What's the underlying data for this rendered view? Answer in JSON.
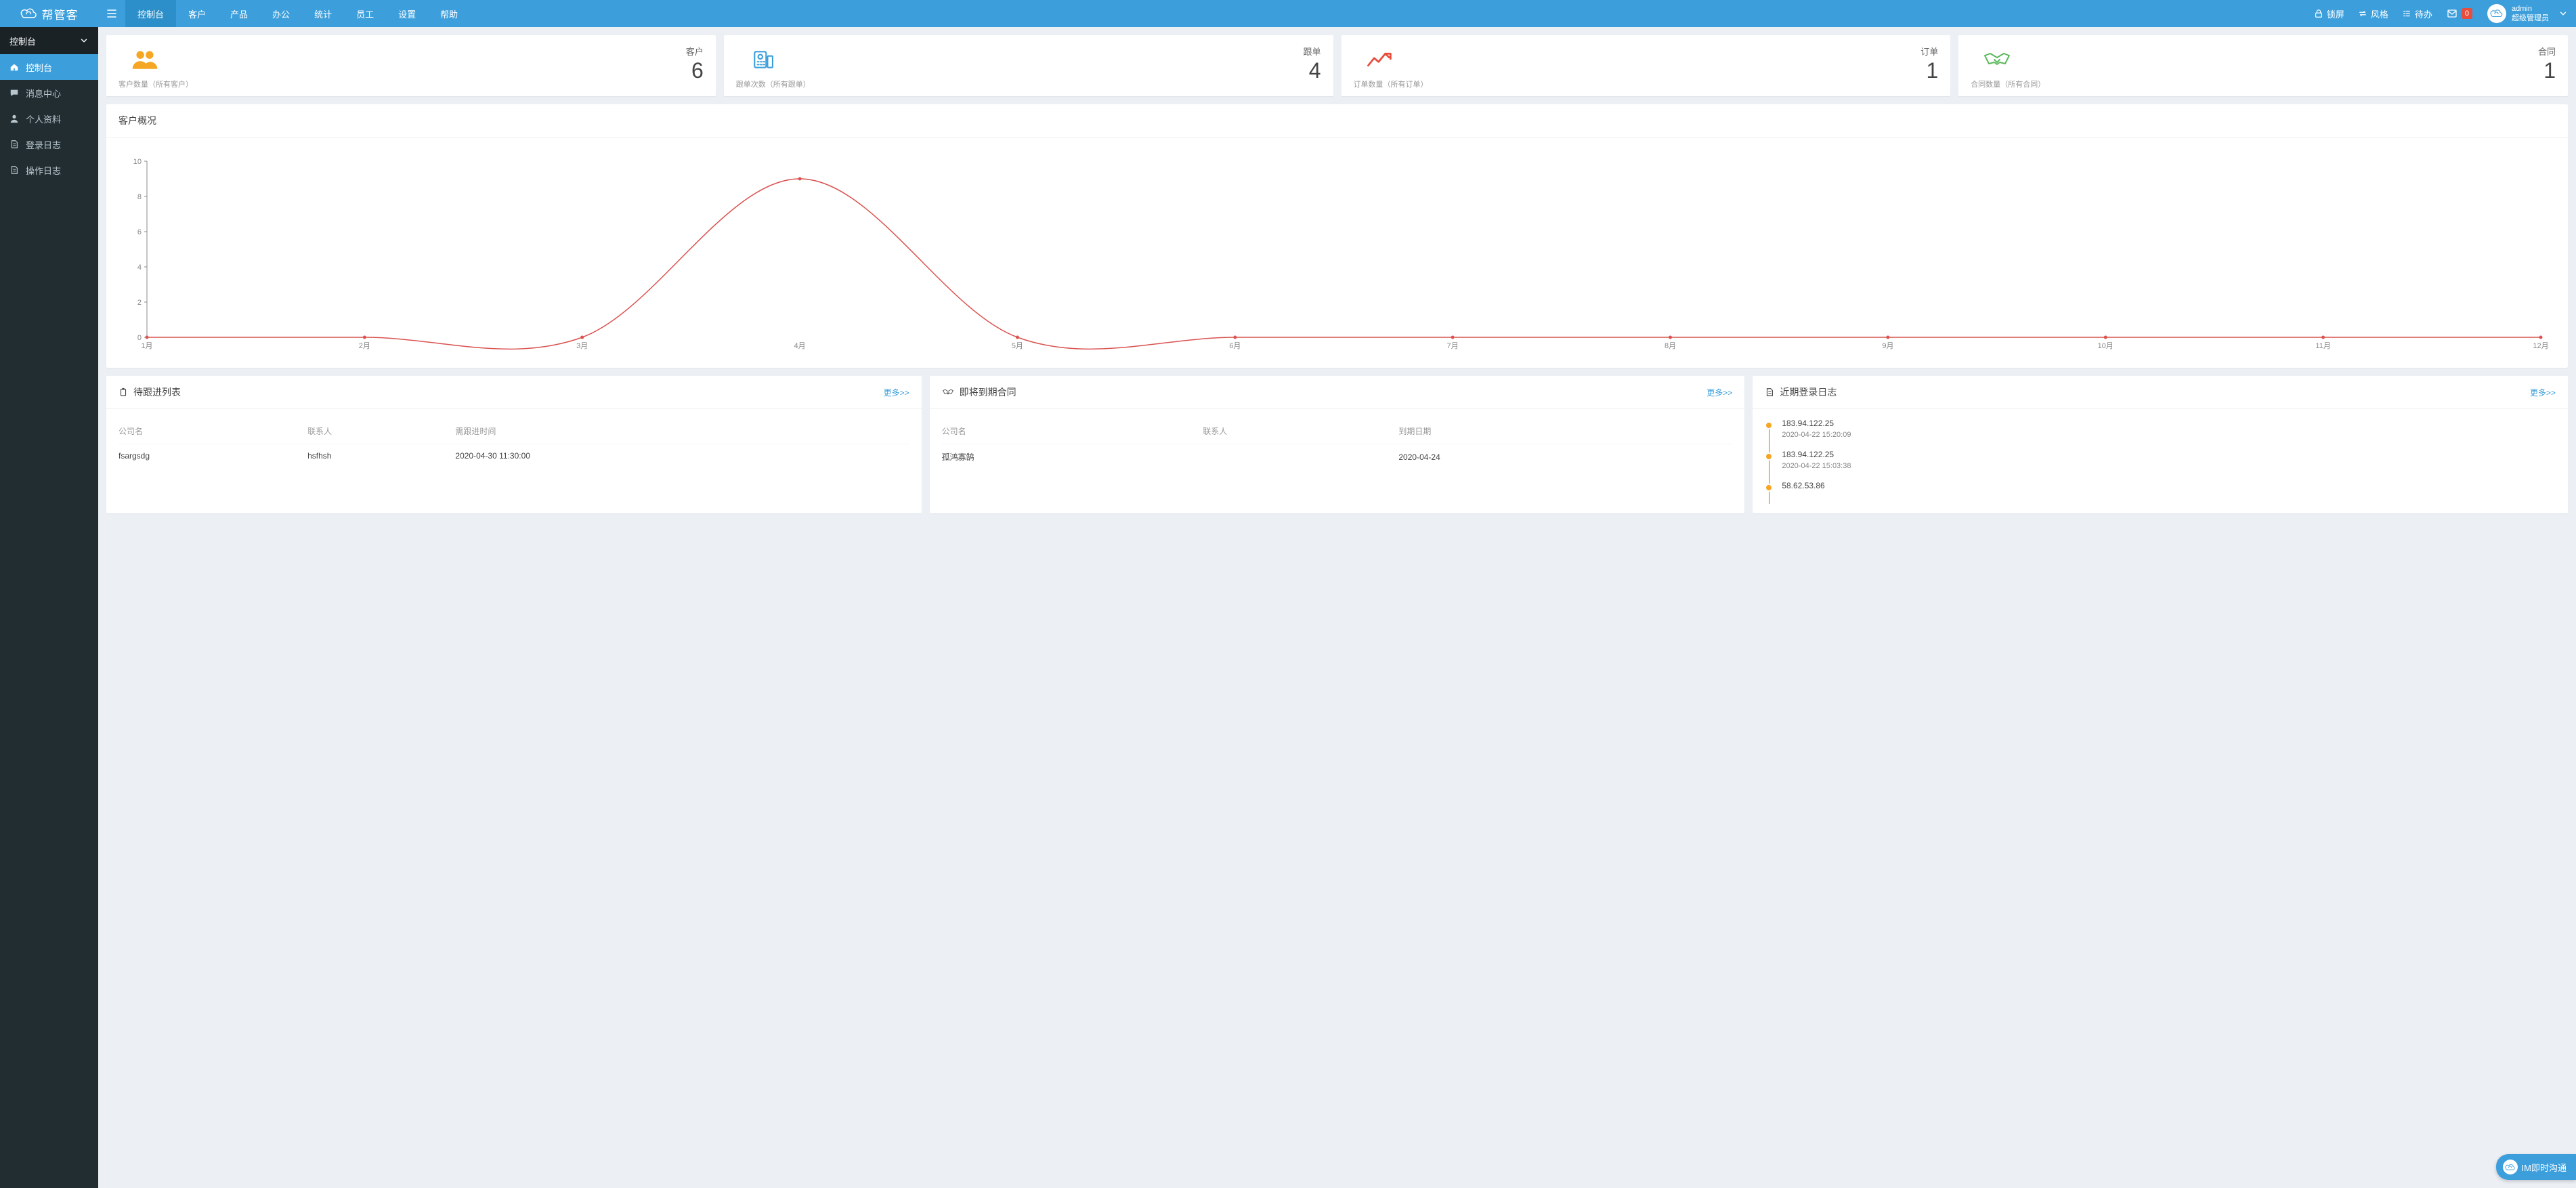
{
  "brand": "帮管客",
  "top_nav": [
    "控制台",
    "客户",
    "产品",
    "办公",
    "统计",
    "员工",
    "设置",
    "帮助"
  ],
  "top_nav_active_index": 0,
  "header_right": {
    "lock": "锁屏",
    "style": "风格",
    "todo": "待办",
    "mail_badge": "0"
  },
  "user": {
    "name": "admin",
    "role": "超级管理员"
  },
  "sidebar_header": "控制台",
  "sidebar_items": [
    {
      "label": "控制台",
      "icon": "home",
      "active": true
    },
    {
      "label": "消息中心",
      "icon": "comment",
      "active": false
    },
    {
      "label": "个人资料",
      "icon": "user",
      "active": false
    },
    {
      "label": "登录日志",
      "icon": "file",
      "active": false
    },
    {
      "label": "操作日志",
      "icon": "file",
      "active": false
    }
  ],
  "stats": [
    {
      "title": "客户",
      "value": "6",
      "sub": "客户数量（所有客户）",
      "icon": "users",
      "color": "#f5a623"
    },
    {
      "title": "跟单",
      "value": "4",
      "sub": "跟单次数（所有跟单）",
      "icon": "fax",
      "color": "#3c9fdc"
    },
    {
      "title": "订单",
      "value": "1",
      "sub": "订单数量（所有订单）",
      "icon": "trend",
      "color": "#e74c3c"
    },
    {
      "title": "合同",
      "value": "1",
      "sub": "合同数量（所有合同）",
      "icon": "handshake",
      "color": "#5cb85c"
    }
  ],
  "chart_panel_title": "客户概况",
  "chart_data": {
    "type": "line",
    "categories": [
      "1月",
      "2月",
      "3月",
      "4月",
      "5月",
      "6月",
      "7月",
      "8月",
      "9月",
      "10月",
      "11月",
      "12月"
    ],
    "values": [
      0,
      0,
      0,
      9,
      0,
      0,
      0,
      0,
      0,
      0,
      0,
      0
    ],
    "title": "客户概况",
    "xlabel": "",
    "ylabel": "",
    "ylim": [
      0,
      10
    ],
    "yticks": [
      0,
      2,
      4,
      6,
      8,
      10
    ]
  },
  "panel_more_label": "更多>>",
  "follow_panel": {
    "title": "待跟进列表",
    "columns": [
      "公司名",
      "联系人",
      "需跟进时间"
    ],
    "rows": [
      {
        "company": "fsargsdg",
        "contact": "hsfhsh",
        "time": "2020-04-30 11:30:00"
      }
    ]
  },
  "contract_panel": {
    "title": "即将到期合同",
    "columns": [
      "公司名",
      "联系人",
      "到期日期"
    ],
    "rows": [
      {
        "company": "孤鸿寡鹄",
        "contact": "",
        "due": "2020-04-24"
      }
    ]
  },
  "login_panel": {
    "title": "近期登录日志",
    "items": [
      {
        "ip": "183.94.122.25",
        "time": "2020-04-22 15:20:09"
      },
      {
        "ip": "183.94.122.25",
        "time": "2020-04-22 15:03:38"
      },
      {
        "ip": "58.62.53.86",
        "time": ""
      }
    ]
  },
  "im_label": "IM即时沟通"
}
